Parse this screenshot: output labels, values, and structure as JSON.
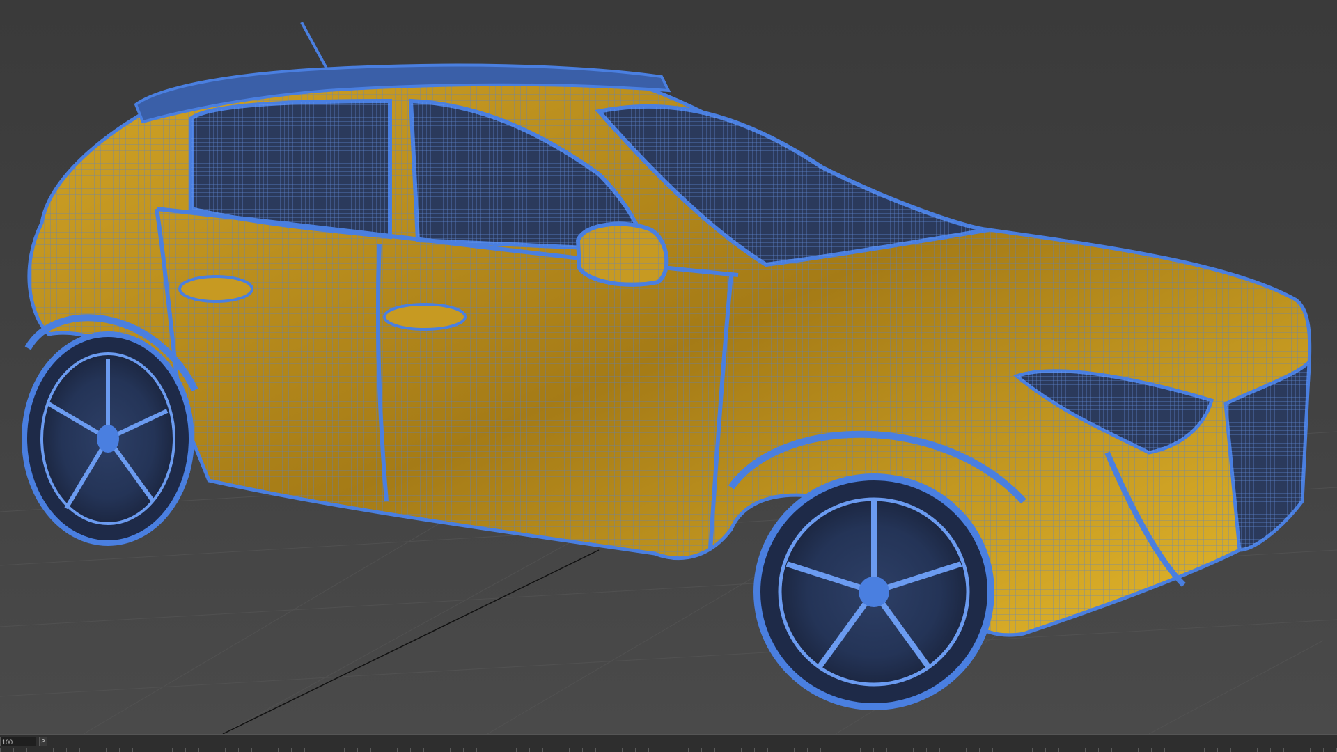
{
  "viewport": {
    "object_name": "hatchback-car-wireframe",
    "colors": {
      "background": "#3f3f3f",
      "grid": "#555555",
      "wire": "#4a7fe0",
      "wire_light": "#6b9bf0",
      "body": "#b98d1e",
      "body_highlight": "#e0b32a",
      "glass": "#2b3a5c"
    }
  },
  "timeline": {
    "frame_value": "100",
    "next_label": ">"
  }
}
